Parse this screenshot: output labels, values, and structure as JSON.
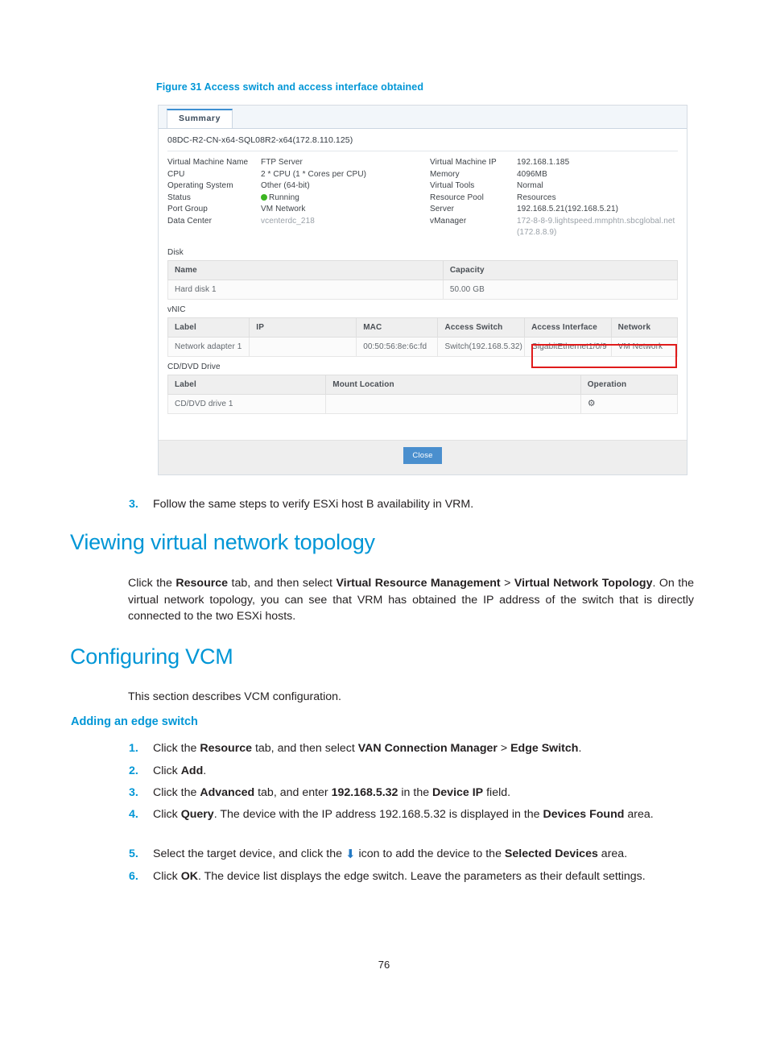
{
  "figure": {
    "caption": "Figure 31 Access switch and access interface obtained",
    "tab_label": "Summary",
    "vm_title": "08DC-R2-CN-x64-SQL08R2-x64(172.8.110.125)",
    "properties_left": [
      {
        "key": "Virtual Machine Name",
        "value": "FTP Server"
      },
      {
        "key": "CPU",
        "value": "2 * CPU  (1 * Cores per CPU)"
      },
      {
        "key": "Operating System",
        "value": "Other (64-bit)"
      },
      {
        "key": "Status",
        "value": "Running"
      },
      {
        "key": "Port Group",
        "value": "VM Network"
      },
      {
        "key": "Data Center",
        "value": "vcenterdc_218"
      }
    ],
    "properties_right": [
      {
        "key": "Virtual Machine IP",
        "value": "192.168.1.185"
      },
      {
        "key": "Memory",
        "value": "4096MB"
      },
      {
        "key": "Virtual Tools",
        "value": "Normal"
      },
      {
        "key": "Resource Pool",
        "value": "Resources"
      },
      {
        "key": "Server",
        "value": "192.168.5.21(192.168.5.21)"
      },
      {
        "key": "vManager",
        "value": "172-8-8-9.lightspeed.mmphtn.sbcglobal.net(172.8.8.9)"
      }
    ],
    "disk": {
      "section_label": "Disk",
      "headers": [
        "Name",
        "Capacity"
      ],
      "rows": [
        [
          "Hard disk 1",
          "50.00 GB"
        ]
      ]
    },
    "vnic": {
      "section_label": "vNIC",
      "headers": [
        "Label",
        "IP",
        "MAC",
        "Access Switch",
        "Access Interface",
        "Network"
      ],
      "rows": [
        [
          "Network adapter 1",
          "",
          "00:50:56:8e:6c:fd",
          "Switch(192.168.5.32)",
          "GigabitEthernet1/0/9",
          "VM Network"
        ]
      ]
    },
    "cddvd": {
      "section_label": "CD/DVD Drive",
      "headers": [
        "Label",
        "Mount Location",
        "Operation"
      ],
      "rows": [
        [
          "CD/DVD drive 1",
          "",
          ""
        ]
      ]
    },
    "close_label": "Close",
    "highlight_color": "#e01b1b",
    "accent_color": "#0096d6",
    "status_color": "#3cb521",
    "button_color": "#4a8fce"
  },
  "body": {
    "step3_num": "3.",
    "step3_text": "Follow the same steps to verify ESXi host B availability in VRM.",
    "heading_topology": "Viewing virtual network topology",
    "para_topology_1": "Click the ",
    "para_topology_b1": "Resource",
    "para_topology_2": " tab, and then select ",
    "para_topology_b2": "Virtual Resource Management",
    "para_topology_3": " > ",
    "para_topology_b3": "Virtual Network Topology",
    "para_topology_4": ". On the virtual network topology, you can see that VRM has obtained the IP address of the switch that is directly connected to the two ESXi hosts.",
    "heading_vcm": "Configuring VCM",
    "para_vcm": "This section describes VCM configuration.",
    "heading_edge": "Adding an edge switch",
    "steps": [
      {
        "num": "1.",
        "parts": [
          {
            "t": "Click the ",
            "b": false
          },
          {
            "t": "Resource",
            "b": true
          },
          {
            "t": " tab, and then select ",
            "b": false
          },
          {
            "t": "VAN Connection Manager",
            "b": true
          },
          {
            "t": " > ",
            "b": false
          },
          {
            "t": "Edge Switch",
            "b": true
          },
          {
            "t": ".",
            "b": false
          }
        ]
      },
      {
        "num": "2.",
        "parts": [
          {
            "t": "Click ",
            "b": false
          },
          {
            "t": "Add",
            "b": true
          },
          {
            "t": ".",
            "b": false
          }
        ]
      },
      {
        "num": "3.",
        "parts": [
          {
            "t": "Click the ",
            "b": false
          },
          {
            "t": "Advanced",
            "b": true
          },
          {
            "t": " tab, and enter ",
            "b": false
          },
          {
            "t": "192.168.5.32",
            "b": true
          },
          {
            "t": " in the ",
            "b": false
          },
          {
            "t": "Device IP",
            "b": true
          },
          {
            "t": " field.",
            "b": false
          }
        ]
      },
      {
        "num": "4.",
        "parts": [
          {
            "t": "Click ",
            "b": false
          },
          {
            "t": "Query",
            "b": true
          },
          {
            "t": ". The device with the IP address 192.168.5.32 is displayed in the ",
            "b": false
          },
          {
            "t": "Devices Found",
            "b": true
          },
          {
            "t": " area.",
            "b": false
          }
        ]
      },
      {
        "num": "5.",
        "parts": [
          {
            "t": "Select the target device, and click the ",
            "b": false
          },
          {
            "t": "⬇",
            "b": false,
            "icon": "down-arrow-icon"
          },
          {
            "t": " icon to add the device to the ",
            "b": false
          },
          {
            "t": "Selected Devices",
            "b": true
          },
          {
            "t": " area.",
            "b": false
          }
        ]
      },
      {
        "num": "6.",
        "parts": [
          {
            "t": "Click ",
            "b": false
          },
          {
            "t": "OK",
            "b": true
          },
          {
            "t": ". The device list displays the edge switch. Leave the parameters as their default settings.",
            "b": false
          }
        ]
      }
    ]
  },
  "footer": {
    "page_number": "76"
  }
}
